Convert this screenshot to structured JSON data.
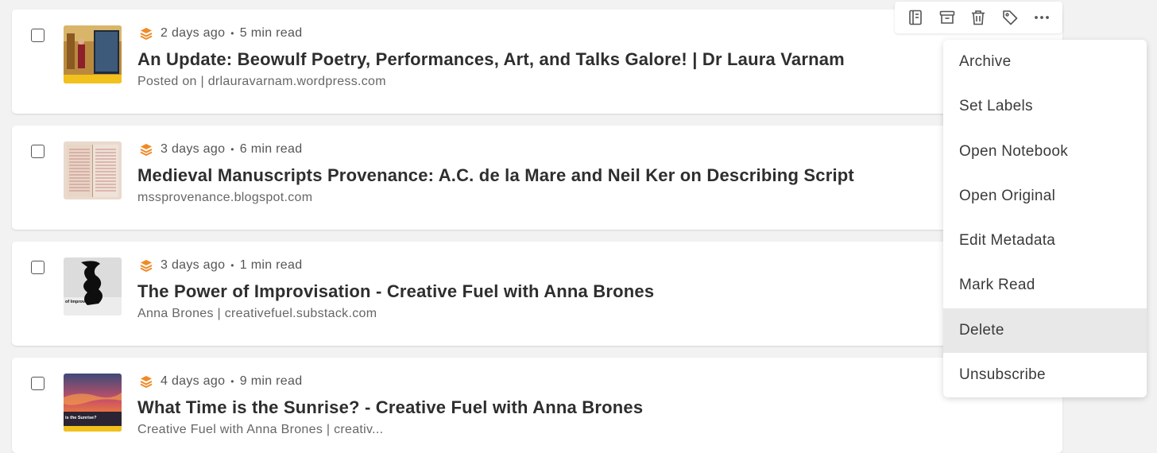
{
  "articles": [
    {
      "meta_age": "2 days ago",
      "meta_sep": "•",
      "meta_read": "5 min read",
      "title": "An Update: Beowulf Poetry, Performances, Art, and Talks Galore! | Dr Laura Varnam",
      "source": "Posted on | drlauravarnam.wordpress.com"
    },
    {
      "meta_age": "3 days ago",
      "meta_sep": "•",
      "meta_read": "6 min read",
      "title": "Medieval Manuscripts Provenance: A.C. de la Mare and Neil Ker on Describing Script",
      "source": "mssprovenance.blogspot.com"
    },
    {
      "meta_age": "3 days ago",
      "meta_sep": "•",
      "meta_read": "1 min read",
      "title": "The Power of Improvisation - Creative Fuel with Anna Brones",
      "source": "Anna Brones | creativefuel.substack.com",
      "thumb_caption": "of Improvisation"
    },
    {
      "meta_age": "4 days ago",
      "meta_sep": "•",
      "meta_read": "9 min read",
      "title": "What Time is the Sunrise? - Creative Fuel with Anna Brones",
      "source": "Creative Fuel with Anna Brones | creativ...",
      "thumb_caption": "is the Sunrise?"
    }
  ],
  "toolbar": {
    "icons": [
      "notebook-icon",
      "archive-icon",
      "trash-icon",
      "tag-icon",
      "more-icon"
    ]
  },
  "menu": {
    "items": [
      "Archive",
      "Set Labels",
      "Open Notebook",
      "Open Original",
      "Edit Metadata",
      "Mark Read",
      "Delete",
      "Unsubscribe"
    ],
    "highlighted": "Delete"
  },
  "colors": {
    "accent": "#f08a24",
    "background": "#f2f2f2",
    "highlight": "#e8e8e8"
  }
}
